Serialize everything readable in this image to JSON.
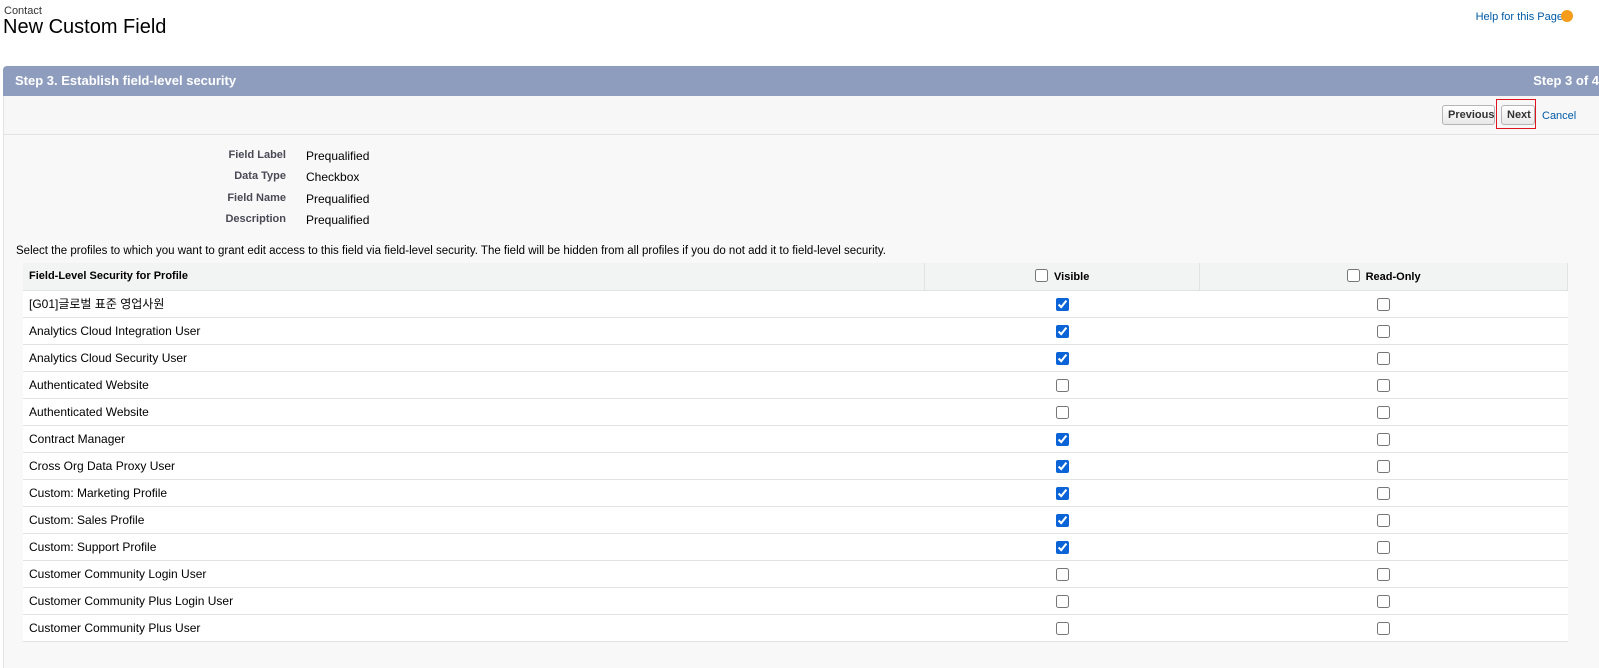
{
  "header": {
    "object_name": "Contact",
    "title": "New Custom Field",
    "help_link": "Help for this Page"
  },
  "step": {
    "title": "Step 3. Establish field-level security",
    "counter": "Step 3 of 4"
  },
  "buttons": {
    "previous": "Previous",
    "next": "Next",
    "cancel": "Cancel"
  },
  "details": [
    {
      "label": "Field Label",
      "value": "Prequalified"
    },
    {
      "label": "Data Type",
      "value": "Checkbox"
    },
    {
      "label": "Field Name",
      "value": "Prequalified"
    },
    {
      "label": "Description",
      "value": "Prequalified"
    }
  ],
  "instructions": "Select the profiles to which you want to grant edit access to this field via field-level security. The field will be hidden from all profiles if you do not add it to field-level security.",
  "table": {
    "headers": {
      "profile": "Field-Level Security for Profile",
      "visible": "Visible",
      "read_only": "Read-Only"
    },
    "header_visible_checked": false,
    "header_read_only_checked": false,
    "rows": [
      {
        "profile": "[G01]글로벌 표준 영업사원",
        "visible": true,
        "read_only": false
      },
      {
        "profile": "Analytics Cloud Integration User",
        "visible": true,
        "read_only": false
      },
      {
        "profile": "Analytics Cloud Security User",
        "visible": true,
        "read_only": false
      },
      {
        "profile": "Authenticated Website",
        "visible": false,
        "read_only": false
      },
      {
        "profile": "Authenticated Website",
        "visible": false,
        "read_only": false
      },
      {
        "profile": "Contract Manager",
        "visible": true,
        "read_only": false
      },
      {
        "profile": "Cross Org Data Proxy User",
        "visible": true,
        "read_only": false
      },
      {
        "profile": "Custom: Marketing Profile",
        "visible": true,
        "read_only": false
      },
      {
        "profile": "Custom: Sales Profile",
        "visible": true,
        "read_only": false
      },
      {
        "profile": "Custom: Support Profile",
        "visible": true,
        "read_only": false
      },
      {
        "profile": "Customer Community Login User",
        "visible": false,
        "read_only": false
      },
      {
        "profile": "Customer Community Plus Login User",
        "visible": false,
        "read_only": false
      },
      {
        "profile": "Customer Community Plus User",
        "visible": false,
        "read_only": false
      }
    ]
  },
  "colors": {
    "step_bar": "#8e9dbe",
    "link": "#015ba7",
    "highlight": "#e0141e",
    "checkbox_accent": "#0b63d8"
  }
}
